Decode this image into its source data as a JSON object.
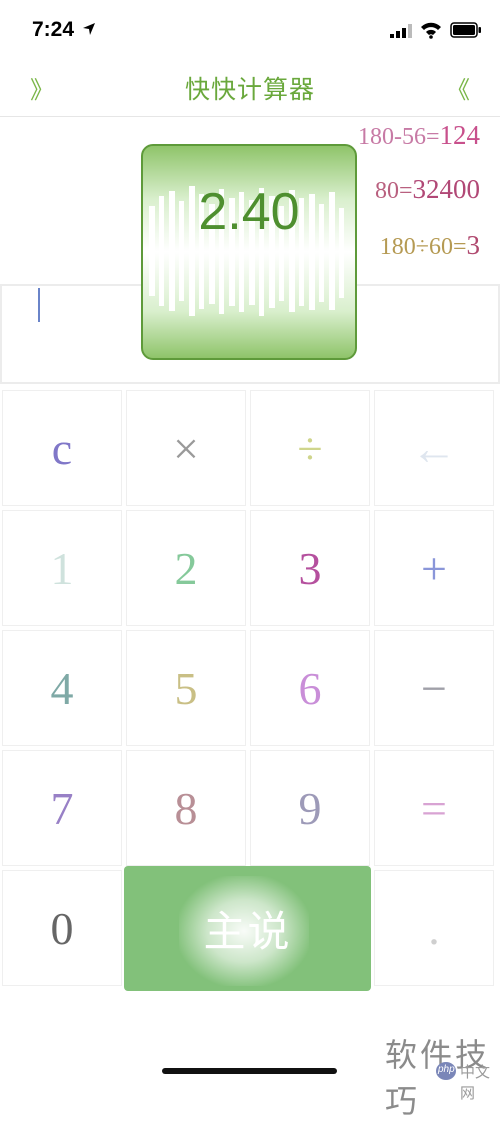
{
  "status": {
    "time": "7:24"
  },
  "nav": {
    "left_label": "》",
    "title": "快快计算器",
    "right_label": "《"
  },
  "history": [
    {
      "expr": "180-56=",
      "result": "124"
    },
    {
      "expr": "80=",
      "result": "32400"
    },
    {
      "expr": "180÷60=",
      "result": "3"
    }
  ],
  "overlay": {
    "value": "2.40"
  },
  "keys": [
    {
      "label": "c",
      "color": "#8077c8"
    },
    {
      "label": "×",
      "color": "#9a9a9a"
    },
    {
      "label": "÷",
      "color": "#cfd58c"
    },
    {
      "label": "←",
      "color": "#dfe6ef"
    },
    {
      "label": "1",
      "color": "#cfe2dd"
    },
    {
      "label": "2",
      "color": "#85c99a"
    },
    {
      "label": "3",
      "color": "#b5509e"
    },
    {
      "label": "+",
      "color": "#8a96d9"
    },
    {
      "label": "4",
      "color": "#7fa9a6"
    },
    {
      "label": "5",
      "color": "#c9bf85"
    },
    {
      "label": "6",
      "color": "#c98ed8"
    },
    {
      "label": "−",
      "color": "#a0a0a8"
    },
    {
      "label": "7",
      "color": "#9880c6"
    },
    {
      "label": "8",
      "color": "#b88f96"
    },
    {
      "label": "9",
      "color": "#9d9ab8"
    },
    {
      "label": "=",
      "color": "#d8a3d3"
    },
    {
      "label": "0",
      "color": "#666666"
    },
    {
      "label": ".",
      "color": "#cfcfcf"
    }
  ],
  "speak_button": {
    "label": "主说",
    "color": "#82c17a"
  },
  "watermark": {
    "text": "软件技巧",
    "php": "php",
    "cn": "中文网"
  }
}
